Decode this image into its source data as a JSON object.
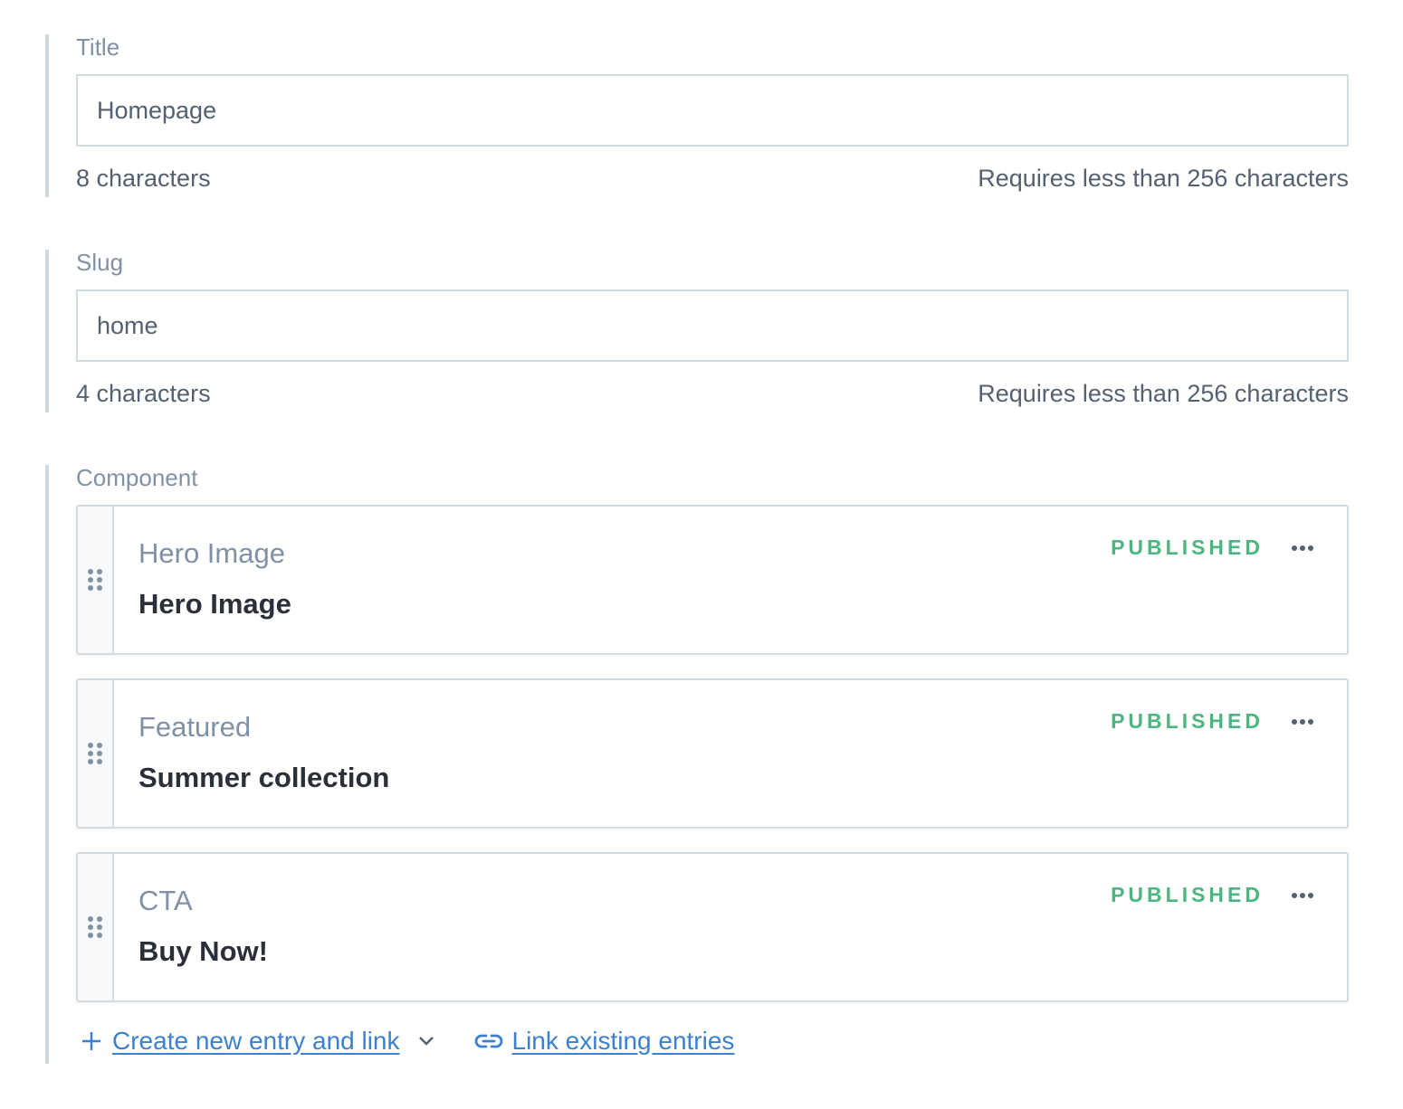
{
  "fields": {
    "title": {
      "label": "Title",
      "value": "Homepage",
      "count": "8 characters",
      "constraint": "Requires less than 256 characters"
    },
    "slug": {
      "label": "Slug",
      "value": "home",
      "count": "4 characters",
      "constraint": "Requires less than 256 characters"
    },
    "component": {
      "label": "Component",
      "entries": [
        {
          "type": "Hero Image",
          "title": "Hero Image",
          "status": "PUBLISHED"
        },
        {
          "type": "Featured",
          "title": "Summer collection",
          "status": "PUBLISHED"
        },
        {
          "type": "CTA",
          "title": "Buy Now!",
          "status": "PUBLISHED"
        }
      ],
      "actions": {
        "create_label": "Create new entry and link",
        "link_label": "Link existing entries"
      }
    }
  },
  "icons": {
    "drag": "drag-handle-icon",
    "more": "more-horizontal-icon",
    "plus": "plus-icon",
    "chevron": "chevron-down-icon",
    "link": "link-icon"
  },
  "colors": {
    "published": "#4cb580",
    "link": "#3c80cf",
    "label": "#8091a5",
    "text": "#536171",
    "border": "#d3dce0"
  }
}
